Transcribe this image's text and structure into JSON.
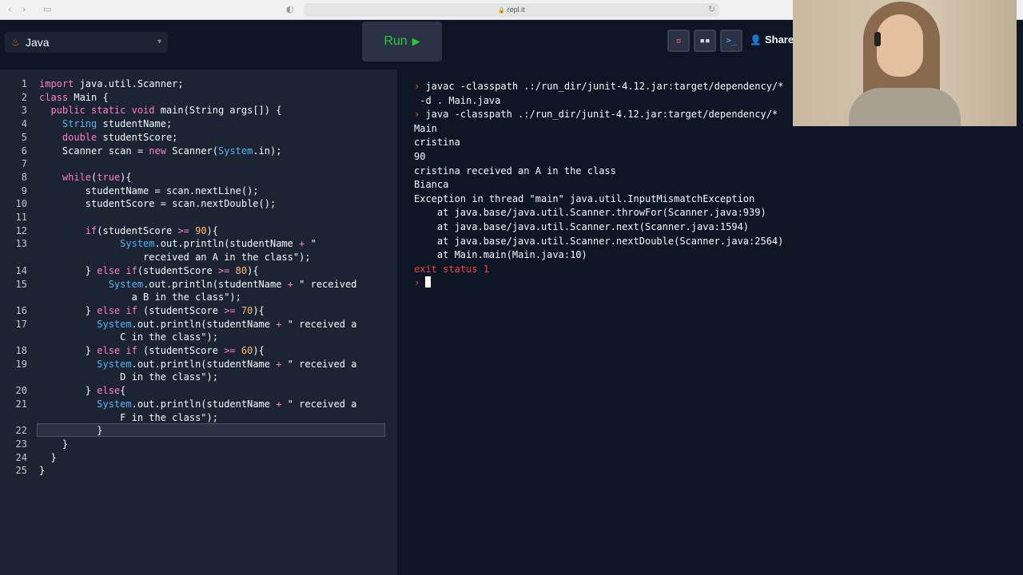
{
  "browser": {
    "url": "repl.it",
    "back_glyph": "‹",
    "forward_glyph": "›",
    "sidebar_glyph": "▭",
    "shield_glyph": "◐",
    "reload_glyph": "↻",
    "lock_glyph": "🔒"
  },
  "toolbar": {
    "language": "Java",
    "language_icon": "♨",
    "chevron": "▾",
    "run_label": "Run",
    "run_glyph": "▶",
    "share_label": "Share",
    "share_icon": "👤",
    "avatars": [
      {
        "glyph": "ಠ"
      },
      {
        "glyph": "▪▪"
      },
      {
        "glyph": ">_"
      }
    ]
  },
  "editor": {
    "active_line": 22,
    "lines": [
      {
        "n": "1",
        "html": "<span class=\"kw\">import</span> java.util.Scanner;"
      },
      {
        "n": "2",
        "html": "<span class=\"kw\">class</span> Main {"
      },
      {
        "n": "3",
        "html": "  <span class=\"kw\">public static void</span> main(String args[]) {"
      },
      {
        "n": "4",
        "html": "    <span class=\"ty\">String</span> studentName;"
      },
      {
        "n": "5",
        "html": "    <span class=\"kw\">double</span> studentScore;"
      },
      {
        "n": "6",
        "html": "    Scanner scan = <span class=\"kw\">new</span> Scanner(<span class=\"cls\">System</span>.in);"
      },
      {
        "n": "7",
        "html": ""
      },
      {
        "n": "8",
        "html": "    <span class=\"kw\">while</span>(<span class=\"kw\">true</span>){"
      },
      {
        "n": "9",
        "html": "        studentName = scan.nextLine();"
      },
      {
        "n": "10",
        "html": "        studentScore = scan.nextDouble();"
      },
      {
        "n": "11",
        "html": ""
      },
      {
        "n": "12",
        "html": "        <span class=\"kw\">if</span>(studentScore <span class=\"op\">&gt;=</span> <span class=\"num\">90</span>){"
      },
      {
        "n": "13",
        "html": "              <span class=\"cls\">System</span>.out.println(studentName <span class=\"op\">+</span> \""
      },
      {
        "n": "",
        "cont": true,
        "html": "                  received an A in the class\");"
      },
      {
        "n": "14",
        "html": "        } <span class=\"kw\">else if</span>(studentScore <span class=\"op\">&gt;=</span> <span class=\"num\">80</span>){"
      },
      {
        "n": "15",
        "html": "            <span class=\"cls\">System</span>.out.println(studentName <span class=\"op\">+</span> \" received"
      },
      {
        "n": "",
        "cont": true,
        "html": "                a B in the class\");"
      },
      {
        "n": "16",
        "html": "        } <span class=\"kw\">else if</span> (studentScore <span class=\"op\">&gt;=</span> <span class=\"num\">70</span>){"
      },
      {
        "n": "17",
        "html": "          <span class=\"cls\">System</span>.out.println(studentName <span class=\"op\">+</span> \" received a"
      },
      {
        "n": "",
        "cont": true,
        "html": "              C in the class\");"
      },
      {
        "n": "18",
        "html": "        } <span class=\"kw\">else if</span> (studentScore <span class=\"op\">&gt;=</span> <span class=\"num\">60</span>){"
      },
      {
        "n": "19",
        "html": "          <span class=\"cls\">System</span>.out.println(studentName <span class=\"op\">+</span> \" received a"
      },
      {
        "n": "",
        "cont": true,
        "html": "              D in the class\");"
      },
      {
        "n": "20",
        "html": "        } <span class=\"kw\">else</span>{"
      },
      {
        "n": "21",
        "html": "          <span class=\"cls\">System</span>.out.println(studentName <span class=\"op\">+</span> \" received a"
      },
      {
        "n": "",
        "cont": true,
        "html": "              F in the class\");"
      },
      {
        "n": "22",
        "html": "          }"
      },
      {
        "n": "23",
        "html": "    }"
      },
      {
        "n": "24",
        "html": "  }"
      },
      {
        "n": "25",
        "html": "}"
      }
    ]
  },
  "terminal": {
    "lines": [
      {
        "prompt": true,
        "text": "javac -classpath .:/run_dir/junit-4.12.jar:target/dependency/*"
      },
      {
        "text": " -d . Main.java"
      },
      {
        "prompt": true,
        "text": "java -classpath .:/run_dir/junit-4.12.jar:target/dependency/*"
      },
      {
        "text": "Main"
      },
      {
        "text": "cristina"
      },
      {
        "text": "90"
      },
      {
        "text": "cristina received an A in the class"
      },
      {
        "text": "Bianca"
      },
      {
        "text": "Exception in thread \"main\" java.util.InputMismatchException"
      },
      {
        "text": "    at java.base/java.util.Scanner.throwFor(Scanner.java:939)"
      },
      {
        "text": "    at java.base/java.util.Scanner.next(Scanner.java:1594)"
      },
      {
        "text": "    at java.base/java.util.Scanner.nextDouble(Scanner.java:2564)"
      },
      {
        "text": "    at Main.main(Main.java:10)"
      },
      {
        "error": true,
        "text": "exit status 1"
      },
      {
        "prompt": true,
        "cursor": true,
        "text": ""
      }
    ]
  },
  "colors": {
    "accent": "#f26207",
    "run": "#27c93f",
    "error": "#f23f42",
    "editor_bg": "#1c2333",
    "terminal_bg": "#0e1525"
  }
}
